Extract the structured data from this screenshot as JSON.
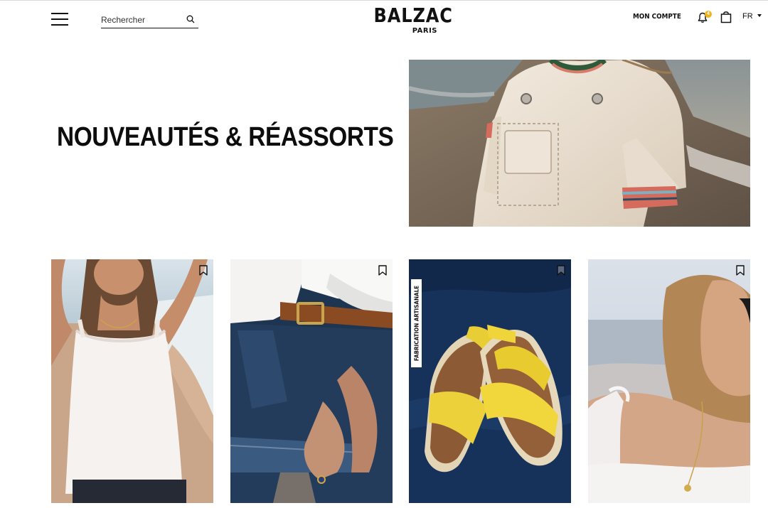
{
  "header": {
    "search_placeholder": "Rechercher",
    "brand": "BALZAC",
    "brand_city": "PARIS",
    "account_label": "MON COMPTE",
    "notification_count": "4",
    "language": "FR"
  },
  "hero": {
    "title": "NOUVEAUTÉS & RÉASSORTS"
  },
  "products": [
    {
      "tag": ""
    },
    {
      "tag": ""
    },
    {
      "tag": "FABRICATION ARTISANALE"
    },
    {
      "tag": ""
    }
  ],
  "colors": {
    "text": "#111111",
    "badge": "#f2b21c",
    "background": "#ffffff"
  }
}
